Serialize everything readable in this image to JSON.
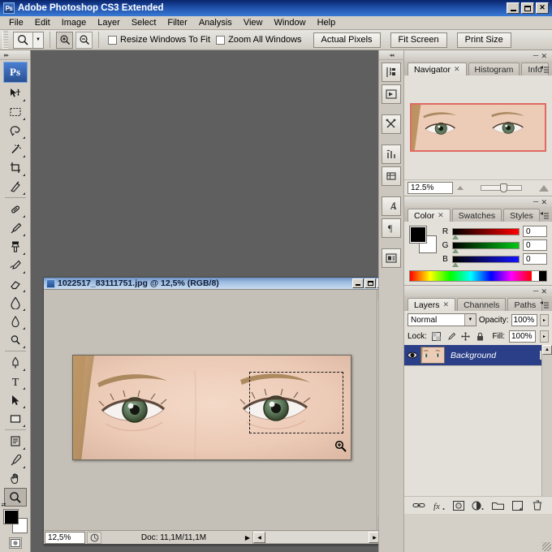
{
  "app": {
    "title": "Adobe Photoshop CS3 Extended",
    "logo_text": "Ps",
    "window_buttons": {
      "minimize": "minimize-button",
      "maximize": "maximize-button",
      "close": "close-button"
    }
  },
  "menubar": {
    "items": [
      "File",
      "Edit",
      "Image",
      "Layer",
      "Select",
      "Filter",
      "Analysis",
      "View",
      "Window",
      "Help"
    ]
  },
  "options_bar": {
    "active_tool": "zoom-tool",
    "zoom_in_label": "zoom-in",
    "zoom_out_label": "zoom-out",
    "checkboxes": [
      {
        "label": "Resize Windows To Fit",
        "checked": false
      },
      {
        "label": "Zoom All Windows",
        "checked": false
      }
    ],
    "buttons": [
      "Actual Pixels",
      "Fit Screen",
      "Print Size"
    ]
  },
  "toolbox": {
    "tools": [
      {
        "name": "move-tool",
        "has_flyout": true
      },
      {
        "name": "rectangular-marquee-tool",
        "has_flyout": true
      },
      {
        "name": "lasso-tool",
        "has_flyout": true
      },
      {
        "name": "magic-wand-tool",
        "has_flyout": true
      },
      {
        "name": "crop-tool",
        "has_flyout": true
      },
      {
        "name": "eyedropper-slice-tool",
        "has_flyout": true
      },
      {
        "name": "healing-brush-tool",
        "has_flyout": true
      },
      {
        "name": "brush-tool",
        "has_flyout": true
      },
      {
        "name": "clone-stamp-tool",
        "has_flyout": true
      },
      {
        "name": "history-brush-tool",
        "has_flyout": true
      },
      {
        "name": "eraser-tool",
        "has_flyout": true
      },
      {
        "name": "gradient-tool",
        "has_flyout": true
      },
      {
        "name": "blur-tool",
        "has_flyout": true
      },
      {
        "name": "dodge-tool",
        "has_flyout": true
      },
      {
        "name": "pen-tool",
        "has_flyout": true
      },
      {
        "name": "horizontal-type-tool",
        "has_flyout": true
      },
      {
        "name": "path-selection-tool",
        "has_flyout": true
      },
      {
        "name": "rectangle-shape-tool",
        "has_flyout": true
      },
      {
        "name": "notes-tool",
        "has_flyout": true
      },
      {
        "name": "eyedropper-tool",
        "has_flyout": true
      },
      {
        "name": "hand-tool",
        "has_flyout": false
      },
      {
        "name": "zoom-tool",
        "has_flyout": false,
        "active": true
      }
    ],
    "foreground_color": "#000000",
    "background_color": "#ffffff",
    "quick_mask_default": "standard-mode",
    "quick_mask_alt": "quick-mask-mode"
  },
  "icon_dock": {
    "buttons": [
      "brushes-panel-icon",
      "tool-presets-panel-icon",
      "clone-source-panel-icon",
      "character-panel-icon",
      "paragraph-panel-icon",
      "layer-comps-panel-icon",
      "measurement-log-panel-icon"
    ]
  },
  "navigator_panel": {
    "tabs": [
      {
        "label": "Navigator",
        "active": true,
        "closable": true
      },
      {
        "label": "Histogram",
        "active": false,
        "closable": false
      },
      {
        "label": "Info",
        "active": false,
        "closable": false
      }
    ],
    "zoom_value": "12.5%",
    "view_box_color": "#e06a63"
  },
  "color_panel": {
    "tabs": [
      {
        "label": "Color",
        "active": true,
        "closable": true
      },
      {
        "label": "Swatches",
        "active": false,
        "closable": false
      },
      {
        "label": "Styles",
        "active": false,
        "closable": false
      }
    ],
    "channels": [
      {
        "label": "R",
        "value": "0"
      },
      {
        "label": "G",
        "value": "0"
      },
      {
        "label": "B",
        "value": "0"
      }
    ],
    "foreground": "#000000",
    "background": "#ffffff"
  },
  "layers_panel": {
    "tabs": [
      {
        "label": "Layers",
        "active": true,
        "closable": true
      },
      {
        "label": "Channels",
        "active": false,
        "closable": false
      },
      {
        "label": "Paths",
        "active": false,
        "closable": false
      }
    ],
    "blend_mode": "Normal",
    "opacity_label": "Opacity:",
    "opacity_value": "100%",
    "lock_label": "Lock:",
    "fill_label": "Fill:",
    "fill_value": "100%",
    "lock_icons": [
      "lock-transparent-pixels-icon",
      "lock-image-pixels-icon",
      "lock-position-icon",
      "lock-all-icon"
    ],
    "layers": [
      {
        "name": "Background",
        "visible": true,
        "locked": true,
        "selected": true
      }
    ],
    "footer_buttons": [
      "link-layers-icon",
      "add-layer-style-icon",
      "add-layer-mask-icon",
      "new-adjustment-layer-icon",
      "new-group-icon",
      "new-layer-icon",
      "delete-layer-icon"
    ]
  },
  "document": {
    "title": "1022517_83111751.jpg @ 12,5% (RGB/8)",
    "zoom": "12,5%",
    "doc_info": "Doc: 11,1M/11,1M",
    "selection": "rectangular-marquee-selection",
    "cursor": "zoom-in-cursor",
    "window_buttons": {
      "minimize": "minimize-button",
      "maximize": "maximize-button",
      "close": "close-button"
    }
  }
}
